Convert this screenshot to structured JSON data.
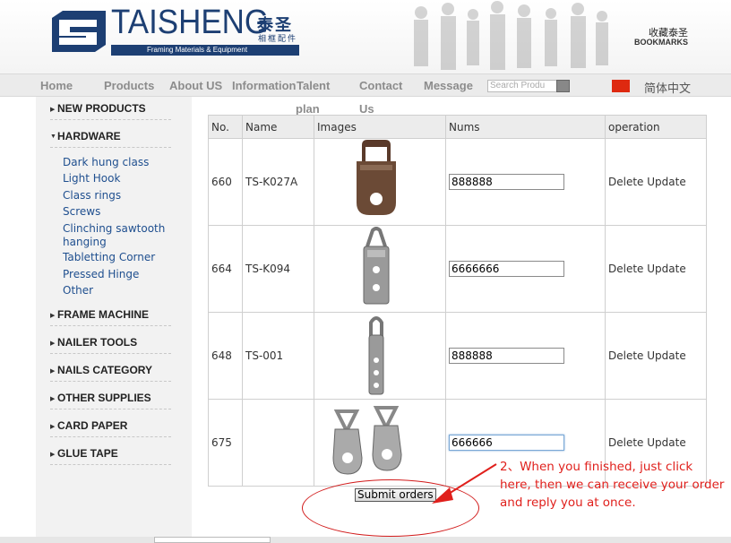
{
  "header": {
    "brand_name": "TAISHENG",
    "brand_cn": "泰圣",
    "brand_cn_sub": "相框配件",
    "tagline": "Framing Materials & Equipment",
    "bookmark_cn": "收藏泰圣",
    "bookmark_en": "BOOKMARKS",
    "brand_color": "#1d3f73"
  },
  "nav": {
    "items": [
      "Home",
      "Products",
      "About US",
      "Information",
      "Talent",
      "Contact",
      "Message"
    ],
    "wrap_plan": "plan",
    "wrap_us": "Us",
    "search_placeholder": "Search Produ",
    "lang": "简体中文"
  },
  "sidebar": {
    "categories": [
      {
        "label": "NEW PRODUCTS"
      },
      {
        "label": "HARDWARE",
        "expanded": true
      },
      {
        "label": "FRAME MACHINE"
      },
      {
        "label": "NAILER TOOLS"
      },
      {
        "label": "NAILS CATEGORY"
      },
      {
        "label": "OTHER SUPPLIES"
      },
      {
        "label": "CARD PAPER"
      },
      {
        "label": "GLUE TAPE"
      }
    ],
    "hardware_items": [
      "Dark hung class",
      "Light Hook",
      "Class rings",
      "Screws",
      "Clinching sawtooth",
      "hanging",
      "Tabletting Corner",
      "Pressed Hinge",
      "Other"
    ]
  },
  "table": {
    "headers": [
      "No.",
      "Name",
      "Images",
      "Nums",
      "operation"
    ],
    "rows": [
      {
        "no": "660",
        "name": "TS-K027A",
        "nums": "888888",
        "image": "d-ring-hanger-bronze"
      },
      {
        "no": "664",
        "name": "TS-K094",
        "nums": "6666666",
        "image": "d-ring-hanger-two-hole"
      },
      {
        "no": "648",
        "name": "TS-001",
        "nums": "888888",
        "image": "d-ring-hanger-three-hole"
      },
      {
        "no": "675",
        "name": "",
        "nums": "666666",
        "image": "triangle-hanger-pair"
      }
    ],
    "delete_label": "Delete",
    "update_label": "Update"
  },
  "submit_label": "Submit orders",
  "annotation": "2、When you finished, just click here, then we can receive your order and reply you at once.",
  "annotation_color": "#e0201c"
}
